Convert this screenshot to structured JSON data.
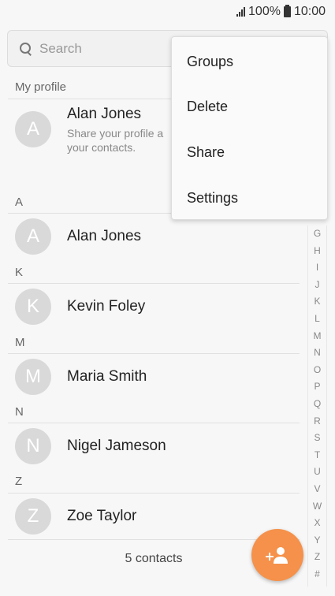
{
  "status": {
    "battery": "100%",
    "time": "10:00"
  },
  "search": {
    "placeholder": "Search"
  },
  "profile": {
    "section_label": "My profile",
    "initial": "A",
    "name": "Alan Jones",
    "subtitle_line1": "Share your profile a",
    "subtitle_line2": "your contacts."
  },
  "contacts": [
    {
      "section": "A",
      "initial": "A",
      "name": "Alan Jones"
    },
    {
      "section": "K",
      "initial": "K",
      "name": "Kevin Foley"
    },
    {
      "section": "M",
      "initial": "M",
      "name": "Maria Smith"
    },
    {
      "section": "N",
      "initial": "N",
      "name": "Nigel Jameson"
    },
    {
      "section": "Z",
      "initial": "Z",
      "name": "Zoe Taylor"
    }
  ],
  "footer": {
    "count": "5 contacts"
  },
  "az_index": [
    "G",
    "H",
    "I",
    "J",
    "K",
    "L",
    "M",
    "N",
    "O",
    "P",
    "Q",
    "R",
    "S",
    "T",
    "U",
    "V",
    "W",
    "X",
    "Y",
    "Z",
    "#"
  ],
  "menu": {
    "items": [
      "Groups",
      "Delete",
      "Share",
      "Settings"
    ]
  },
  "colors": {
    "fab": "#f5914a",
    "avatar": "#d9d9d9"
  }
}
